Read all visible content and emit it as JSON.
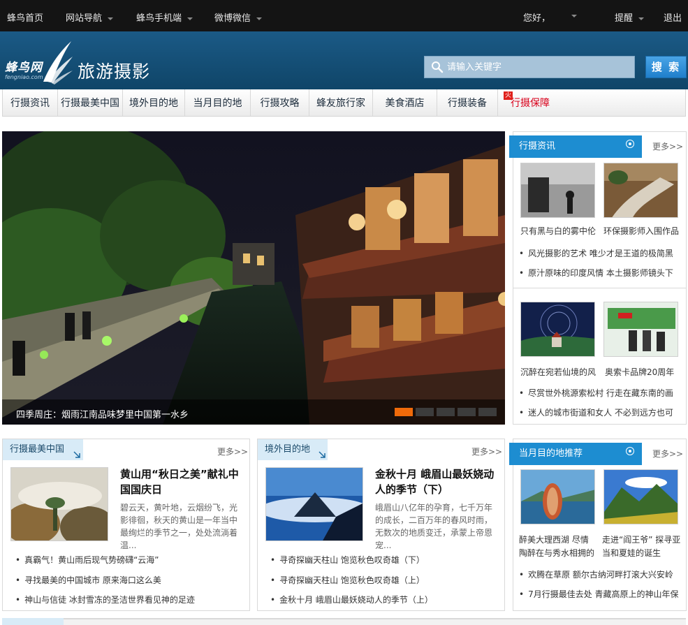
{
  "topbar": {
    "home": "蜂鸟首页",
    "site_nav": "网站导航",
    "mobile": "蜂鸟手机端",
    "weibo": "微博微信",
    "greeting": "您好，",
    "remind": "提醒",
    "logout": "退出"
  },
  "header": {
    "logo_text": "蜂鸟网",
    "logo_sub": "fengniao.com",
    "section_title": "旅游摄影",
    "search_placeholder": "请输入关键字",
    "search_button": "搜 索"
  },
  "nav": {
    "tabs": [
      "行摄资讯",
      "行摄最美中国",
      "境外目的地",
      "当月目的地",
      "行摄攻略",
      "蜂友旅行家",
      "美食酒店",
      "行摄装备",
      "行摄保障"
    ],
    "hot_badge": "火"
  },
  "hero": {
    "caption": "四季周庄：烟雨江南品味梦里中国第一水乡",
    "slide_count": 5,
    "active_slide": 1
  },
  "news_panel": {
    "title": "行摄资讯",
    "more": "更多>>",
    "group1": {
      "thumbs": [
        "只有黑与白的雾中伦",
        "环保摄影师入围作品"
      ],
      "items": [
        "风光摄影的艺术 唯少才是王道的极简黑",
        "原汁原味的印度风情 本土摄影师镜头下"
      ]
    },
    "group2": {
      "thumbs": [
        "沉醉在宛若仙境的风",
        "奥索卡品牌20周年"
      ],
      "items": [
        "尽赏世外桃源索松村 行走在藏东南的画",
        "迷人的城市街道和女人 不必到远方也可"
      ]
    }
  },
  "china_panel": {
    "title": "行摄最美中国",
    "more": "更多>>",
    "feature_title": "黄山用“秋日之美”献礼中国国庆日",
    "feature_desc": "碧云天，黄叶地，云烟纷飞，光影徘徊，秋天的黄山是一年当中最绚烂的季节之一，处处流淌着温...",
    "items": [
      "真霸气！黄山雨后现气势磅礴“云海”",
      "寻找最美的中国城市 原来海口这么美",
      "神山与信徒 冰封雪冻的圣洁世界看见神的足迹"
    ]
  },
  "abroad_panel": {
    "title": "境外目的地",
    "more": "更多>>",
    "feature_title": "金秋十月 峨眉山最妖娆动人的季节（下）",
    "feature_desc": "峨眉山八亿年的孕育，七千万年的成长，二百万年的春风时雨，无数次的地质变迁，承蒙上帝恩宠...",
    "items": [
      "寻奇探幽天柱山 饱览秋色叹奇雄（下）",
      "寻奇探幽天柱山 饱览秋色叹奇雄（上）",
      "金秋十月 峨眉山最妖娆动人的季节（上）"
    ]
  },
  "month_panel": {
    "title": "当月目的地推荐",
    "more": "更多>>",
    "thumbs": [
      {
        "line1": "醉美大理西湖 尽情",
        "line2": "陶醉在与秀水相拥的"
      },
      {
        "line1": "走进“阎王爷” 探寻亚",
        "line2": "当和夏娃的诞生"
      }
    ],
    "items": [
      "欢腾在草原 额尔古纳河畔打滚大兴安岭",
      "7月行摄最佳去处 青藏高原上的神山年保"
    ]
  },
  "colors": {
    "topbar": "#141414",
    "header": "#1b5a86",
    "accent_blue": "#1d8dd1",
    "hot_red": "#d9001b",
    "slide_active": "#f06a0a"
  }
}
